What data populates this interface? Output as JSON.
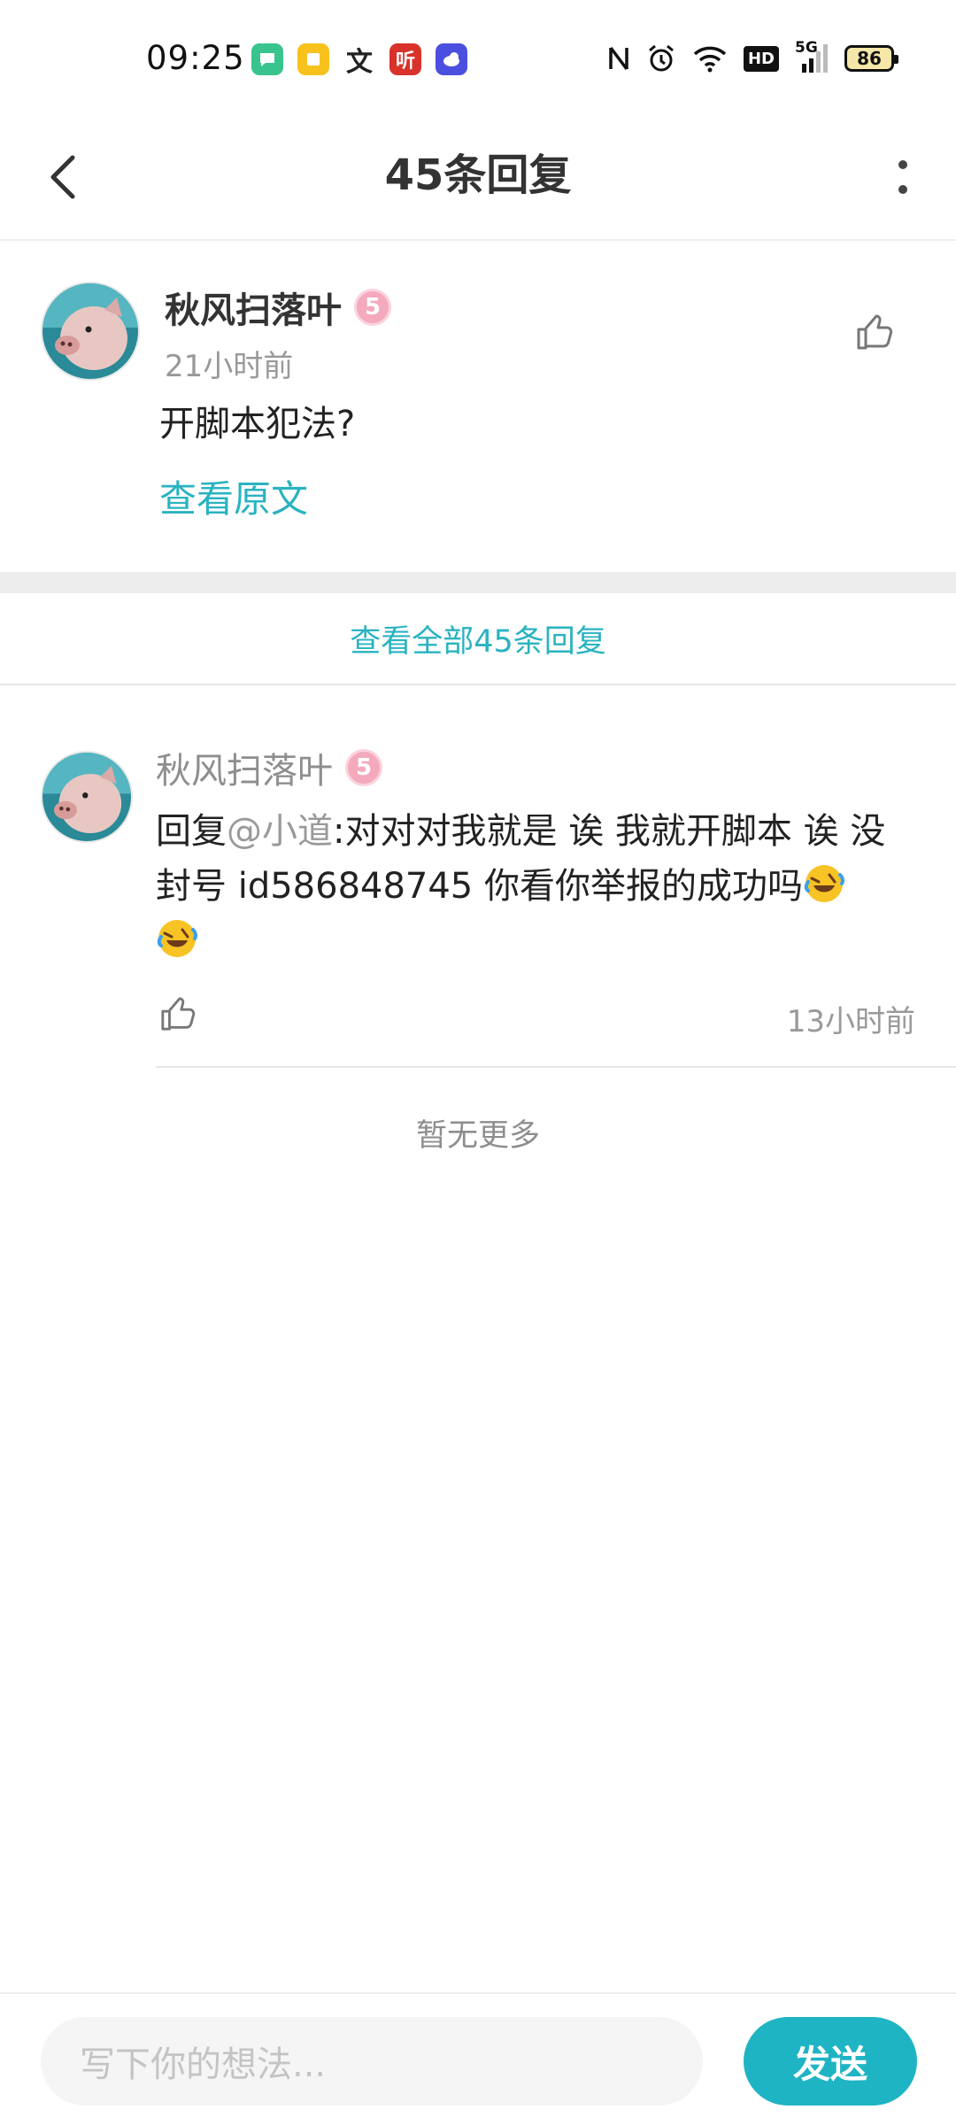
{
  "status_bar": {
    "time": "09:25",
    "battery": "86",
    "app_icons": [
      "message-icon",
      "note-icon",
      "translate-icon",
      "listen-icon",
      "weather-icon"
    ],
    "app_icon_colors": [
      "#3ac48d",
      "#f7c21b",
      "#222222",
      "#d8322a",
      "#4b4fe0"
    ],
    "listen_app_label": "听",
    "translate_glyph": "文",
    "indicators": [
      "nfc-icon",
      "alarm-icon",
      "wifi-icon",
      "hd-icon",
      "signal-5g-icon"
    ],
    "hd_label": "HD",
    "network_label": "5G"
  },
  "header": {
    "title": "45条回复"
  },
  "main_comment": {
    "username": "秋风扫落叶",
    "level": "5",
    "time": "21小时前",
    "text": "开脚本犯法?",
    "view_original": "查看原文"
  },
  "view_all_replies": "查看全部45条回复",
  "reply": {
    "username": "秋风扫落叶",
    "level": "5",
    "prefix": "回复",
    "mention": "@小道",
    "text": ":对对对我就是 诶  我就开脚本 诶 没封号 id586848745  你看你举报的成功吗",
    "time": "13小时前"
  },
  "no_more": "暂无更多",
  "composer": {
    "placeholder": "写下你的想法...",
    "send_label": "发送"
  },
  "colors": {
    "accent": "#1fb4c3",
    "link": "#2ab3c0",
    "badge": "#f4a9bd"
  }
}
